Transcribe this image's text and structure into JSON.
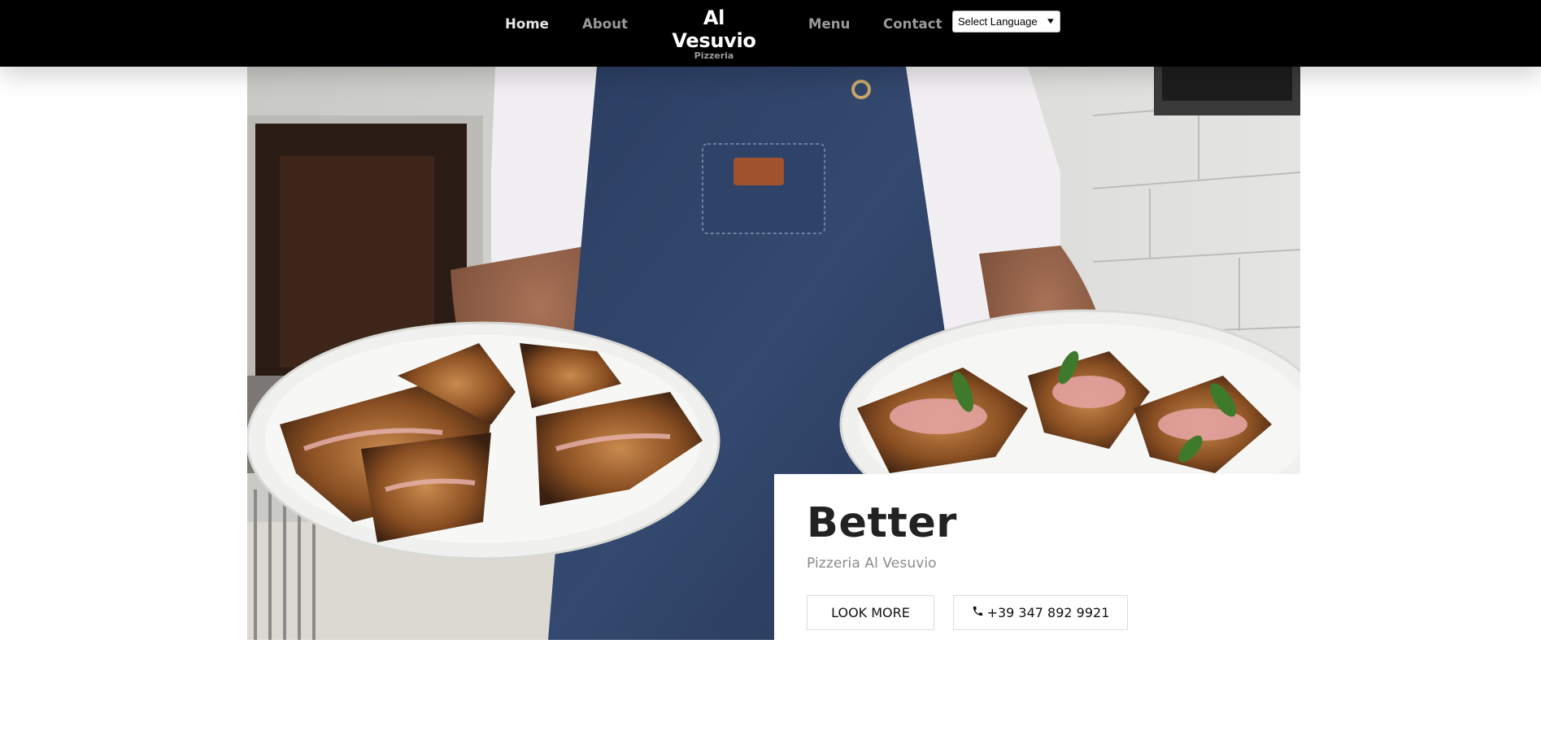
{
  "header": {
    "nav": {
      "home": "Home",
      "about": "About",
      "menu": "Menu",
      "contact": "Contact"
    },
    "brand": {
      "name": "Al Vesuvio",
      "subtitle": "Pizzeria"
    },
    "language_select": {
      "selected": "Select Language",
      "icon": "chevron-down-icon"
    }
  },
  "hero": {
    "image_subject": "chef-holding-two-plates-photo"
  },
  "card": {
    "title": "Better",
    "subtitle": "Pizzeria Al Vesuvio",
    "look_more_label": "LOOK MORE",
    "phone_label": "+39 347 892 9921",
    "phone_icon": "phone-icon"
  },
  "colors": {
    "header_bg": "#000000",
    "nav_active": "#e6e6e6",
    "nav_inactive": "#9a9a9a",
    "title_text": "#222222",
    "subtitle_text": "#8a8a8a"
  }
}
